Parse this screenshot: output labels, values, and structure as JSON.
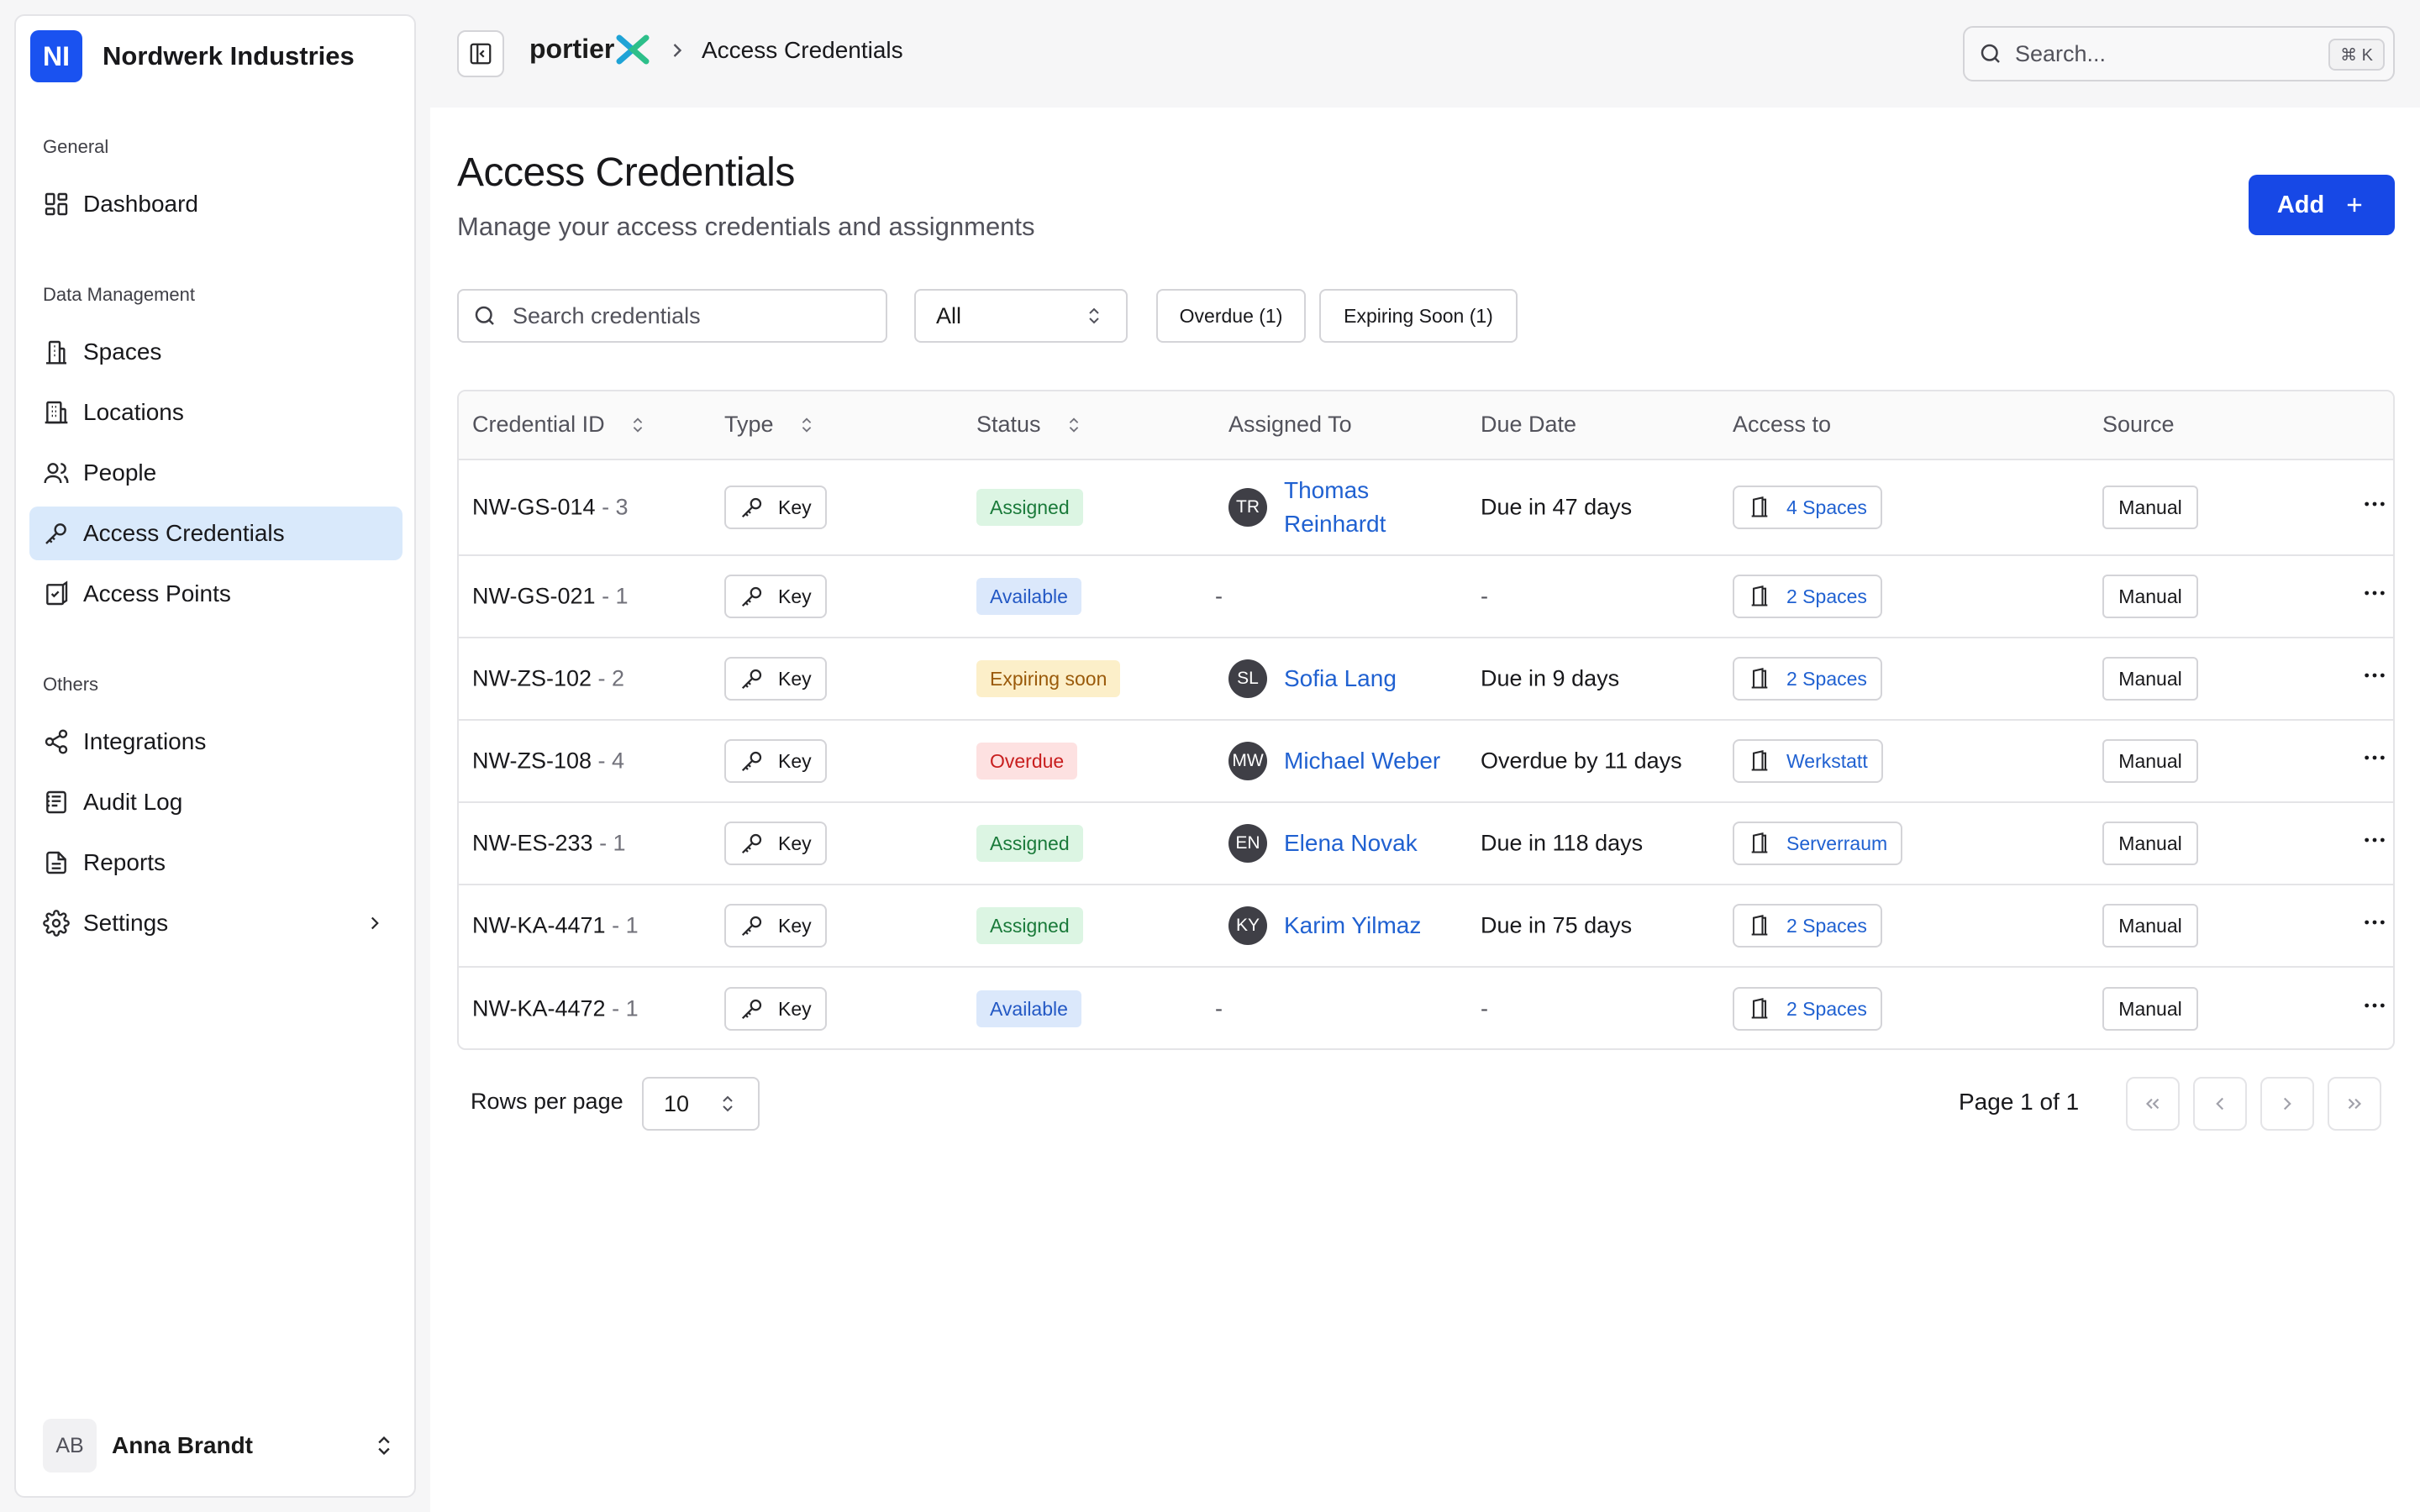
{
  "sidebar": {
    "brand": {
      "initials": "NI",
      "name": "Nordwerk Industries"
    },
    "sections": [
      {
        "title": "General"
      },
      {
        "title": "Data Management"
      },
      {
        "title": "Others"
      }
    ],
    "items": [
      {
        "label": "Dashboard",
        "icon": "dashboard-icon"
      },
      {
        "label": "Spaces",
        "icon": "building-icon"
      },
      {
        "label": "Locations",
        "icon": "locations-icon"
      },
      {
        "label": "People",
        "icon": "people-icon"
      },
      {
        "label": "Access Credentials",
        "icon": "key-icon",
        "active": true
      },
      {
        "label": "Access Points",
        "icon": "access-point-icon"
      },
      {
        "label": "Integrations",
        "icon": "share-icon"
      },
      {
        "label": "Audit Log",
        "icon": "audit-log-icon"
      },
      {
        "label": "Reports",
        "icon": "report-icon"
      },
      {
        "label": "Settings",
        "icon": "gear-icon"
      }
    ],
    "user": {
      "initials": "AB",
      "name": "Anna Brandt"
    }
  },
  "topbar": {
    "logo_text": "portier",
    "breadcrumb": "Access Credentials",
    "search_placeholder": "Search...",
    "shortcut": "⌘ K"
  },
  "page": {
    "title": "Access Credentials",
    "subtitle": "Manage your access credentials and assignments",
    "add_label": "Add"
  },
  "filters": {
    "search_placeholder": "Search credentials",
    "status_value": "All",
    "chips": [
      "Overdue (1)",
      "Expiring Soon (1)"
    ]
  },
  "table": {
    "columns": [
      "Credential ID",
      "Type",
      "Status",
      "Assigned To",
      "Due Date",
      "Access to",
      "Source"
    ],
    "rows": [
      {
        "id": "NW-GS-014",
        "suffix": "- 3",
        "type": "Key",
        "status": "Assigned",
        "initials": "TR",
        "assignee": "Thomas Reinhardt",
        "due": "Due in 47 days",
        "access": "4 Spaces",
        "source": "Manual"
      },
      {
        "id": "NW-GS-021",
        "suffix": "- 1",
        "type": "Key",
        "status": "Available",
        "initials": "",
        "assignee": "-",
        "due": "-",
        "access": "2 Spaces",
        "source": "Manual"
      },
      {
        "id": "NW-ZS-102",
        "suffix": "- 2",
        "type": "Key",
        "status": "Expiring soon",
        "initials": "SL",
        "assignee": "Sofia Lang",
        "due": "Due in 9 days",
        "access": "2 Spaces",
        "source": "Manual"
      },
      {
        "id": "NW-ZS-108",
        "suffix": "- 4",
        "type": "Key",
        "status": "Overdue",
        "initials": "MW",
        "assignee": "Michael Weber",
        "due": "Overdue by 11 days",
        "access": "Werkstatt",
        "source": "Manual"
      },
      {
        "id": "NW-ES-233",
        "suffix": "- 1",
        "type": "Key",
        "status": "Assigned",
        "initials": "EN",
        "assignee": "Elena Novak",
        "due": "Due in 118 days",
        "access": "Serverraum",
        "source": "Manual"
      },
      {
        "id": "NW-KA-4471",
        "suffix": "- 1",
        "type": "Key",
        "status": "Assigned",
        "initials": "KY",
        "assignee": "Karim Yilmaz",
        "due": "Due in 75 days",
        "access": "2 Spaces",
        "source": "Manual"
      },
      {
        "id": "NW-KA-4472",
        "suffix": "- 1",
        "type": "Key",
        "status": "Available",
        "initials": "",
        "assignee": "-",
        "due": "-",
        "access": "2 Spaces",
        "source": "Manual"
      }
    ]
  },
  "pagination": {
    "rows_per_page_label": "Rows per page",
    "rows_per_page": "10",
    "page_info": "Page 1 of 1"
  },
  "colors": {
    "accent": "#1748e6",
    "assigned_bg": "#dcf5e3",
    "assigned_fg": "#1a7a3a",
    "available_bg": "#dbe8fb",
    "available_fg": "#2358c4",
    "expiring_bg": "#fcefc9",
    "expiring_fg": "#9a5a0a",
    "overdue_bg": "#fde1e1",
    "overdue_fg": "#c81e1e"
  }
}
